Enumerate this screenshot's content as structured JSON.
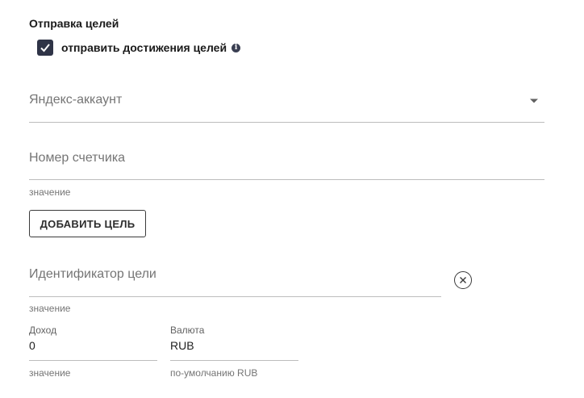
{
  "section": {
    "title": "Отправка целей"
  },
  "send_goals": {
    "checked": true,
    "label": "отправить достижения целей",
    "info_icon": "info-icon"
  },
  "yandex_account": {
    "placeholder": "Яндекс-аккаунт",
    "icon": "chevron-down-icon"
  },
  "counter_number": {
    "placeholder": "Номер счетчика",
    "hint": "значение"
  },
  "add_goal_button": {
    "label": "ДОБАВИТЬ ЦЕЛЬ"
  },
  "goal_id": {
    "placeholder": "Идентификатор цели",
    "hint": "значение",
    "clear_icon": "close-icon"
  },
  "income": {
    "label": "Доход",
    "value": "0",
    "hint": "значение"
  },
  "currency": {
    "label": "Валюта",
    "value": "RUB",
    "hint": "по-умолчанию RUB"
  }
}
